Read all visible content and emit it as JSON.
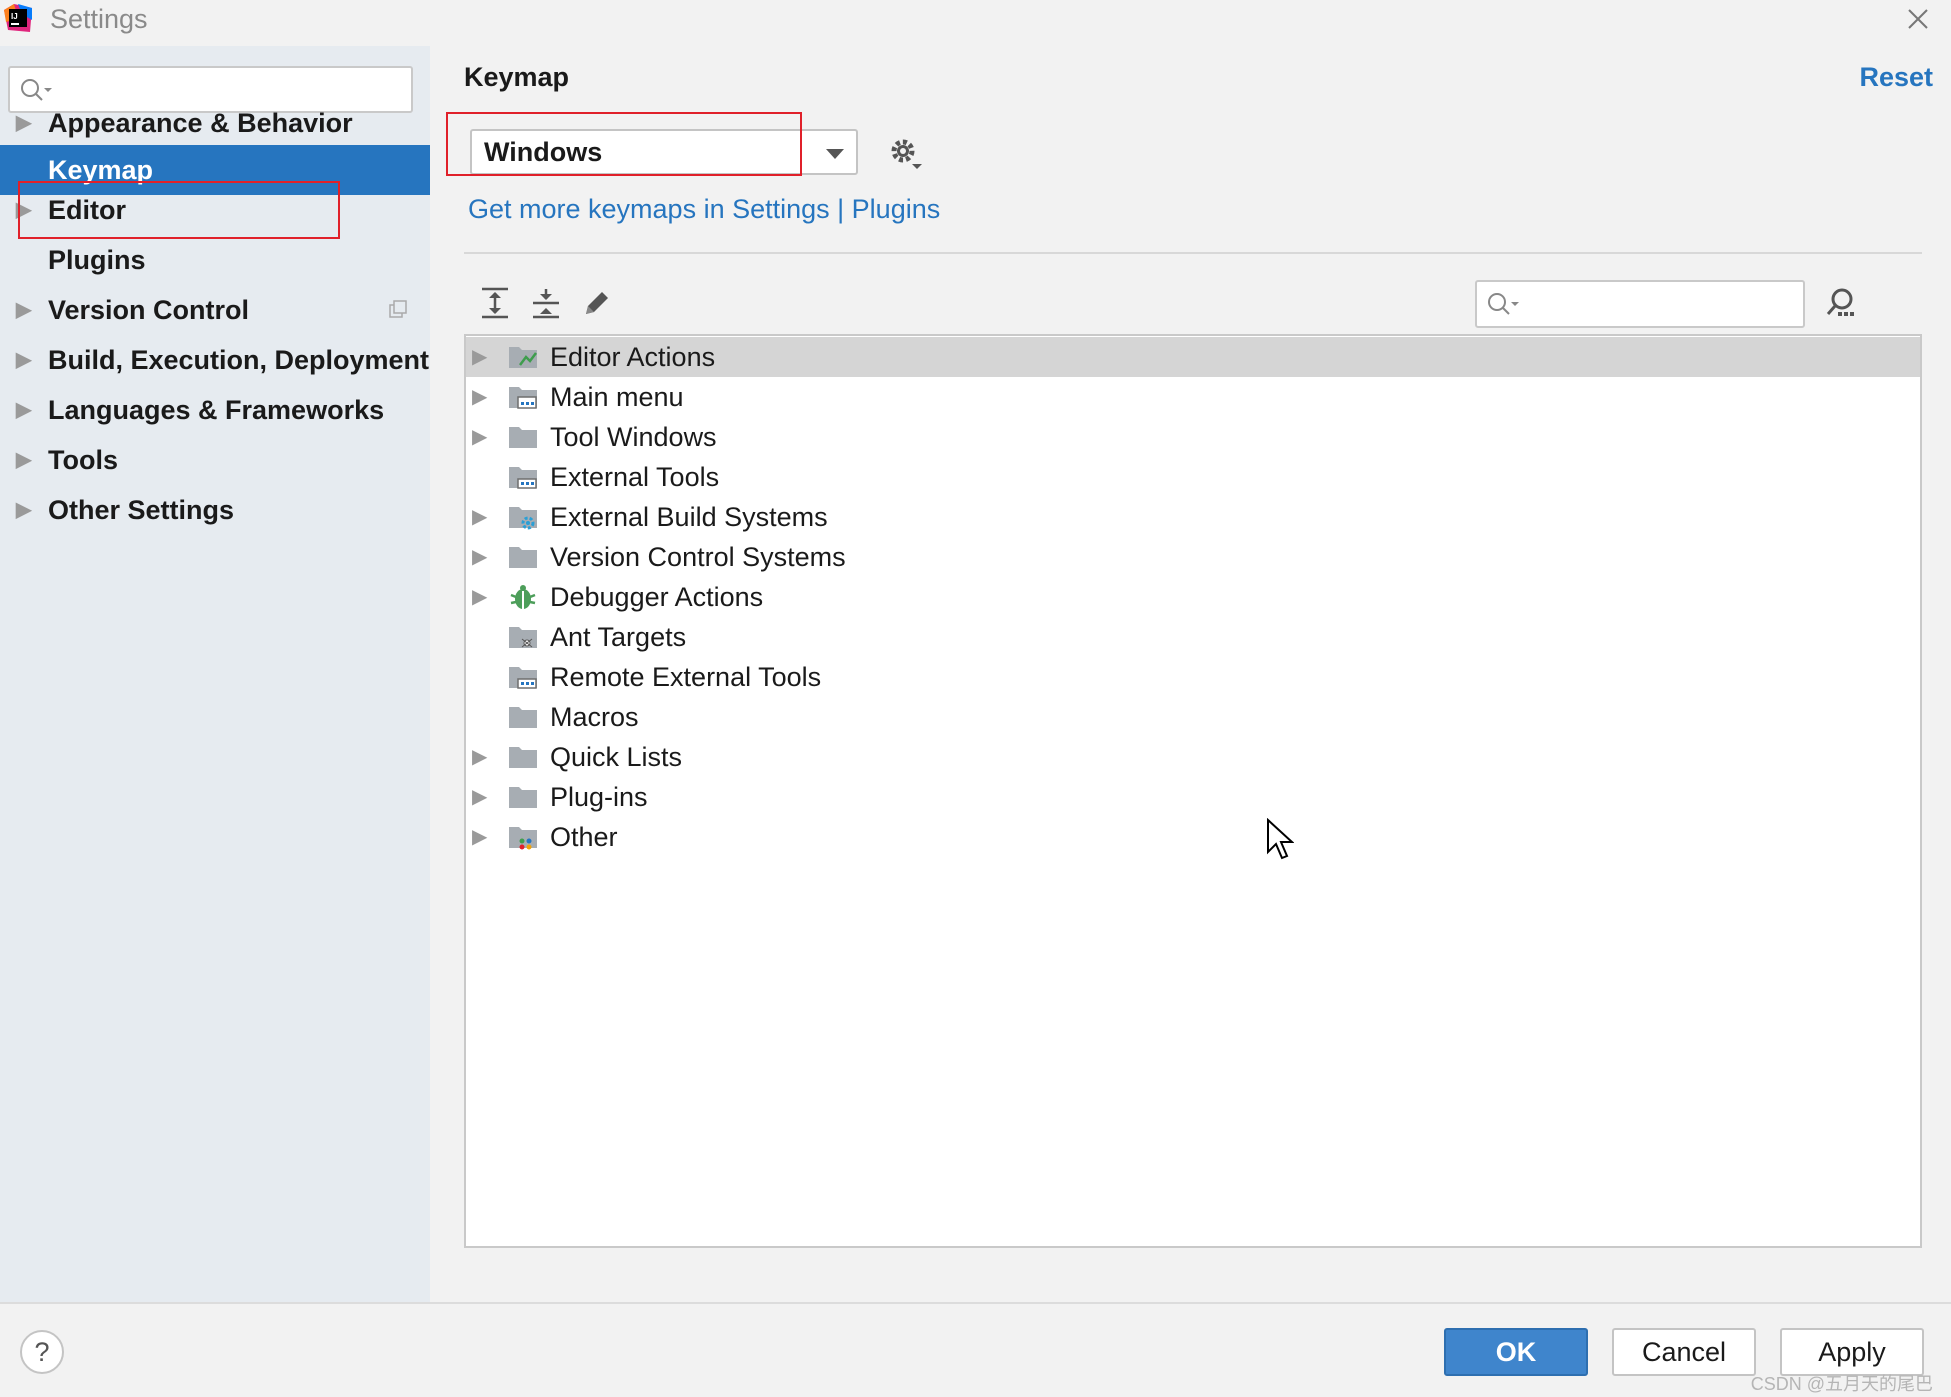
{
  "window": {
    "title": "Settings"
  },
  "sidebar": {
    "search": {
      "value": "",
      "placeholder": ""
    },
    "items": [
      {
        "label": "Appearance & Behavior",
        "expandable": true
      },
      {
        "label": "Keymap",
        "expandable": false,
        "selected": true
      },
      {
        "label": "Editor",
        "expandable": true
      },
      {
        "label": "Plugins",
        "expandable": false
      },
      {
        "label": "Version Control",
        "expandable": true
      },
      {
        "label": "Build, Execution, Deployment",
        "expandable": true
      },
      {
        "label": "Languages & Frameworks",
        "expandable": true
      },
      {
        "label": "Tools",
        "expandable": true
      },
      {
        "label": "Other Settings",
        "expandable": true
      }
    ]
  },
  "main": {
    "title": "Keymap",
    "reset_label": "Reset",
    "keymap_select": {
      "value": "Windows"
    },
    "keymaps_link": "Get more keymaps in Settings | Plugins",
    "filter": {
      "value": "",
      "placeholder": ""
    },
    "tree": [
      {
        "label": "Editor Actions",
        "expandable": true,
        "icon": "editor-actions-folder-icon",
        "highlighted": true
      },
      {
        "label": "Main menu",
        "expandable": true,
        "icon": "main-menu-folder-icon"
      },
      {
        "label": "Tool Windows",
        "expandable": true,
        "icon": "folder-icon"
      },
      {
        "label": "External Tools",
        "expandable": false,
        "icon": "external-tools-folder-icon"
      },
      {
        "label": "External Build Systems",
        "expandable": true,
        "icon": "build-systems-folder-icon"
      },
      {
        "label": "Version Control Systems",
        "expandable": true,
        "icon": "folder-icon"
      },
      {
        "label": "Debugger Actions",
        "expandable": true,
        "icon": "bug-icon"
      },
      {
        "label": "Ant Targets",
        "expandable": false,
        "icon": "ant-folder-icon"
      },
      {
        "label": "Remote External Tools",
        "expandable": false,
        "icon": "external-tools-folder-icon"
      },
      {
        "label": "Macros",
        "expandable": false,
        "icon": "folder-icon"
      },
      {
        "label": "Quick Lists",
        "expandable": true,
        "icon": "folder-icon"
      },
      {
        "label": "Plug-ins",
        "expandable": true,
        "icon": "folder-icon"
      },
      {
        "label": "Other",
        "expandable": true,
        "icon": "other-folder-icon"
      }
    ]
  },
  "footer": {
    "help_label": "?",
    "ok_label": "OK",
    "cancel_label": "Cancel",
    "apply_label": "Apply",
    "watermark": "CSDN @五月天的尾巴"
  },
  "colors": {
    "accent": "#2675bf",
    "sidebar_bg": "#e6ebf0",
    "highlight_box": "#e0202a",
    "ok_button": "#3f85cc"
  }
}
